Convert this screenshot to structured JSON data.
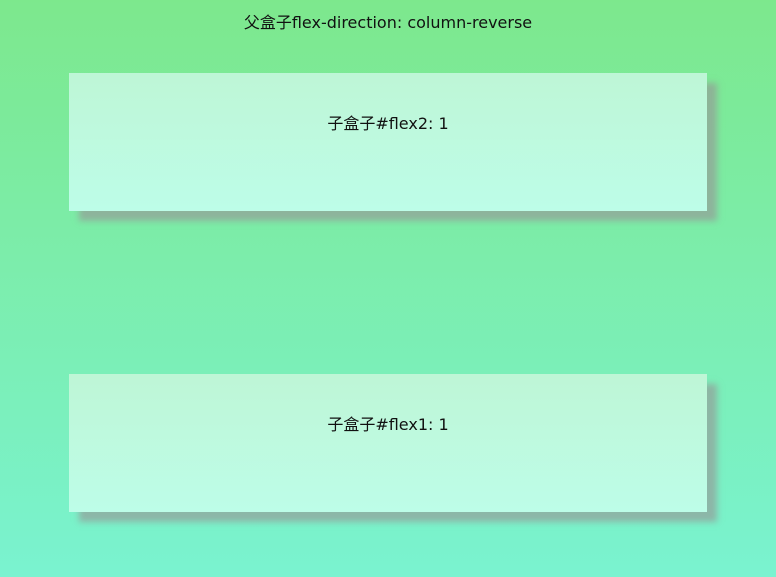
{
  "parent": {
    "label": "父盒子flex-direction: column-reverse"
  },
  "children": [
    {
      "label": "子盒子#flex2: 1"
    },
    {
      "label": "子盒子#flex1: 1"
    }
  ]
}
